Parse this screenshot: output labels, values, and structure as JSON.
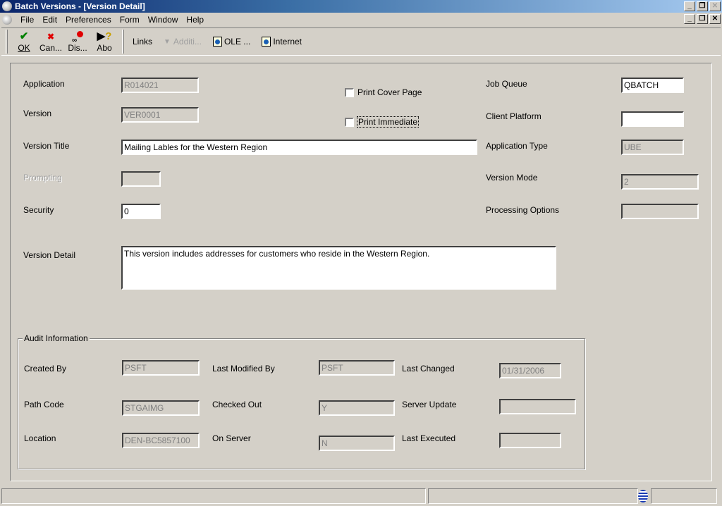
{
  "window": {
    "title": "Batch Versions - [Version Detail]",
    "controls": {
      "minimize": "_",
      "restore": "❐",
      "close": "✕"
    }
  },
  "menu": [
    "File",
    "Edit",
    "Preferences",
    "Form",
    "Window",
    "Help"
  ],
  "toolbar": {
    "buttons": [
      {
        "label": "OK",
        "icon": "check-icon",
        "glyph": "✔",
        "color": "#008000"
      },
      {
        "label": "Can...",
        "icon": "x-icon",
        "glyph": "✖",
        "color": "#e00000"
      },
      {
        "label": "Dis...",
        "icon": "glasses-icon",
        "glyph": "👓",
        "color": "#e00000"
      },
      {
        "label": "Abo",
        "icon": "help-cursor-icon",
        "glyph": "?",
        "color": "#c8a000"
      }
    ],
    "links_label": "Links",
    "additional_label": "Additi...",
    "ole_label": "OLE ...",
    "internet_label": "Internet"
  },
  "form": {
    "application": {
      "label": "Application",
      "value": "R014021"
    },
    "version": {
      "label": "Version",
      "value": "VER0001"
    },
    "version_title": {
      "label": "Version Title",
      "value": "Mailing Lables for the Western Region"
    },
    "prompting": {
      "label": "Prompting",
      "value": ""
    },
    "security": {
      "label": "Security",
      "value": "0"
    },
    "version_detail": {
      "label": "Version Detail",
      "value": "This version includes addresses for customers who reside in the Western Region."
    },
    "print_cover_page": {
      "label": "Print Cover Page",
      "checked": false
    },
    "print_immediate": {
      "label": "Print Immediate",
      "checked": false
    },
    "job_queue": {
      "label": "Job Queue",
      "value": "QBATCH"
    },
    "client_platform": {
      "label": "Client Platform",
      "value": ""
    },
    "application_type": {
      "label": "Application Type",
      "value": "UBE"
    },
    "version_mode": {
      "label": "Version Mode",
      "value": "2"
    },
    "processing_options": {
      "label": "Processing Options",
      "value": ""
    }
  },
  "audit": {
    "title": "Audit Information",
    "created_by": {
      "label": "Created By",
      "value": "PSFT"
    },
    "last_modified_by": {
      "label": "Last Modified By",
      "value": "PSFT"
    },
    "last_changed": {
      "label": "Last Changed",
      "value": "01/31/2006"
    },
    "path_code": {
      "label": "Path Code",
      "value": "STGAIMG"
    },
    "checked_out": {
      "label": "Checked Out",
      "value": "Y"
    },
    "server_update": {
      "label": "Server Update",
      "value": ""
    },
    "location": {
      "label": "Location",
      "value": "DEN-BC5857100"
    },
    "on_server": {
      "label": "On Server",
      "value": "N"
    },
    "last_executed": {
      "label": "Last Executed",
      "value": ""
    }
  }
}
